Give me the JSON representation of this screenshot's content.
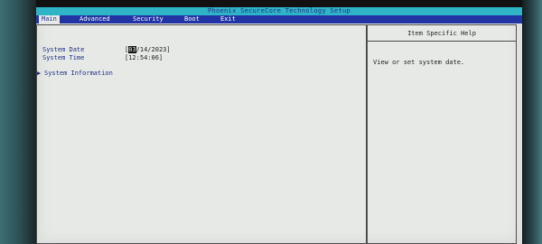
{
  "title": "Phoenix SecureCore Technology Setup",
  "menu": {
    "items": [
      {
        "label": "Main"
      },
      {
        "label": "Advanced"
      },
      {
        "label": "Security"
      },
      {
        "label": "Boot"
      },
      {
        "label": "Exit"
      }
    ]
  },
  "main": {
    "fields": [
      {
        "label": "System Date",
        "value_bracket_open": "[",
        "value_cursor": "03",
        "value_rest": "/14/2023]"
      },
      {
        "label": "System Time",
        "value": "[12:54:06]"
      }
    ],
    "submenu": {
      "arrow": "▶",
      "label": "System Information"
    }
  },
  "help": {
    "header": "Item Specific Help",
    "text": "View or set system date."
  },
  "colors": {
    "title_bar": "#2fb3c6",
    "menu_bar": "#2234a4",
    "screen_bg": "#e7e9e7",
    "label_text": "#1e2f86"
  }
}
